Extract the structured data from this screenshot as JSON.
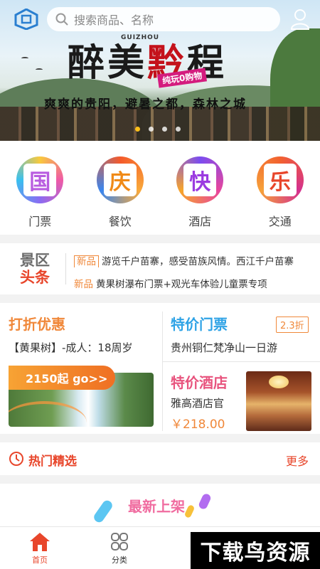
{
  "search": {
    "placeholder": "搜索商品、名称",
    "icon": "search-icon"
  },
  "banner": {
    "title_part1": "醉美",
    "title_part2": "黔",
    "title_part3": "程",
    "logo_text": "GUIZHOU",
    "tag": "纯玩0购物",
    "subtitle": "爽爽的贵阳，避暑之都，森林之城",
    "slide_count": 4,
    "active_slide": 1
  },
  "categories": [
    {
      "glyph": "国",
      "label": "门票"
    },
    {
      "glyph": "庆",
      "label": "餐饮"
    },
    {
      "glyph": "快",
      "label": "酒店"
    },
    {
      "glyph": "乐",
      "label": "交通"
    }
  ],
  "headlines": {
    "logo_line1": "景区",
    "logo_line2": "头条",
    "items": [
      {
        "tag": "新品",
        "text": "游览千户苗寨，感受苗族风情。西江千户苗寨"
      },
      {
        "tag": "新品",
        "text": "黄果树瀑布门票+观光车体验儿童票专项"
      }
    ]
  },
  "deals": {
    "discount": {
      "title": "打折优惠",
      "desc": "【黄果树】-成人：18周岁",
      "button": "2150起 go>>"
    },
    "special_ticket": {
      "title": "特价门票",
      "badge": "2.3折",
      "desc": "贵州铜仁梵净山一日游"
    },
    "special_hotel": {
      "title": "特价酒店",
      "name": "雅高酒店官",
      "price": "￥218.00"
    }
  },
  "hot": {
    "title": "热门精选",
    "more": "更多"
  },
  "new_arrivals": {
    "title": "最新上架"
  },
  "tabbar": [
    {
      "label": "首页",
      "icon": "home-icon"
    },
    {
      "label": "分类",
      "icon": "category-icon"
    }
  ],
  "watermark": "下载鸟资源",
  "colors": {
    "accent": "#e8462b",
    "orange": "#f0883a",
    "blue": "#2fa3e6",
    "pink": "#e8547e"
  }
}
